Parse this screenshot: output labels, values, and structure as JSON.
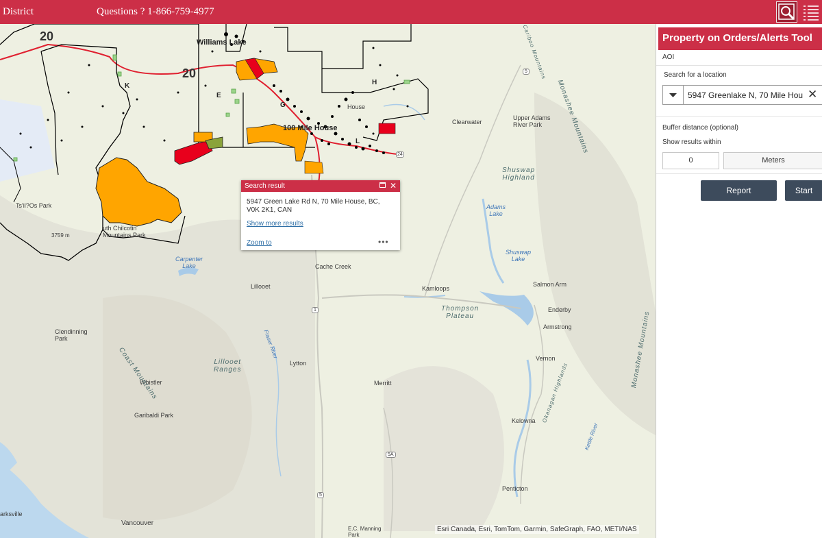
{
  "header": {
    "district_label": "District",
    "questions_label": "Questions ?  1-866-759-4977",
    "icons": {
      "search_tool": "map-search-icon",
      "layer_list": "layer-list-icon"
    }
  },
  "map": {
    "towns": {
      "williams_lake": "Williams Lake",
      "hundred_mile": "100 Mile House",
      "clearwater": "Clearwater",
      "cache_creek": "Cache Creek",
      "lillooet": "Lillooet",
      "kamloops": "Kamloops",
      "salmon_arm": "Salmon Arm",
      "enderby": "Enderby",
      "armstrong": "Armstrong",
      "vernon": "Vernon",
      "lytton": "Lytton",
      "merritt": "Merritt",
      "whistler": "Whistler",
      "kelowna": "Kelowna",
      "penticton": "Penticton",
      "vancouver": "Vancouver",
      "parksville": "arksville",
      "upper_adams": "Upper Adams\nRiver Park",
      "clendinning": "Clendinning\nPark",
      "garibaldi": "Garibaldi Park",
      "manning": "E.C. Manning\nPark",
      "tsilhqotin": "Ts'il?Os Park",
      "chilcotin": "uth Chilcotin\nMountains Park",
      "elev": "3759 m",
      "house": "House"
    },
    "regions": {
      "shuswap": "Shuswap\nHighland",
      "thompson": "Thompson\nPlateau",
      "coast_mtns": "Coast Mountains",
      "lillooet_ranges": "Lillooet\nRanges",
      "monashee_n": "Monashee Mountains",
      "monashee_s": "Monashee Mountains",
      "okanagan": "Okanagan Highlands",
      "cariboo": "Cariboo Mountains"
    },
    "water": {
      "carpenter": "Carpenter\nLake",
      "adams": "Adams\nLake",
      "shuswap_lake": "Shuswap\nLake",
      "fraser": "Fraser River",
      "kettle": "Kettle River"
    },
    "zones": {
      "k": "K",
      "e": "E",
      "g": "G",
      "h": "H",
      "l": "L"
    },
    "routes": {
      "r20_a": "20",
      "r20_b": "20",
      "r5_a": "5",
      "r5_b": "5",
      "r1": "1",
      "r5a": "5A",
      "r24": "24"
    },
    "attribution": "Esri Canada, Esri, TomTom, Garmin, SafeGraph, FAO, METI/NAS",
    "colors": {
      "alert_orange": "#ffa500",
      "alert_red": "#e8001c",
      "district_line": "#000000",
      "highway": "#e02030"
    }
  },
  "popup": {
    "title": "Search result",
    "address": "5947 Green Lake Rd N, 70 Mile House, BC, V0K 2K1, CAN",
    "more_link": "Show more results",
    "zoom_link": "Zoom to",
    "menu": "•••"
  },
  "panel": {
    "title": "Property on Orders/Alerts Tool",
    "aoi_label": "AOI",
    "search_label": "Search for a location",
    "search_value": "5947 Greenlake N, 70 Mile Hou",
    "buffer_label": "Buffer distance (optional)",
    "within_label": "Show results within",
    "buffer_value": "0",
    "unit_value": "Meters",
    "report_button": "Report",
    "start_button": "Start"
  }
}
